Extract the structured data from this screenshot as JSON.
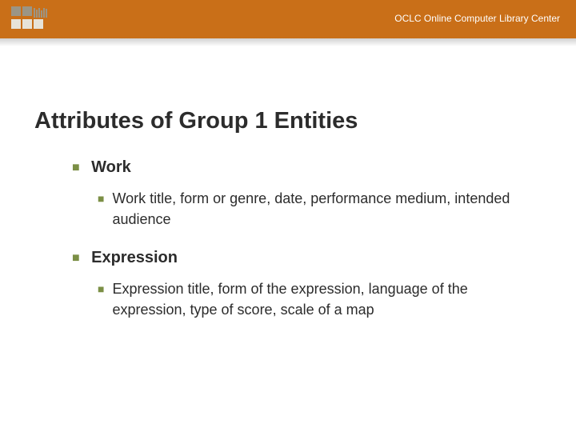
{
  "header": {
    "org_text": "OCLC Online Computer Library Center"
  },
  "title": "Attributes of Group 1 Entities",
  "items": [
    {
      "heading": "Work",
      "detail": "Work title, form or genre, date, performance medium, intended audience"
    },
    {
      "heading": "Expression",
      "detail": "Expression title, form of the expression, language of the expression, type of score, scale of a map"
    }
  ]
}
